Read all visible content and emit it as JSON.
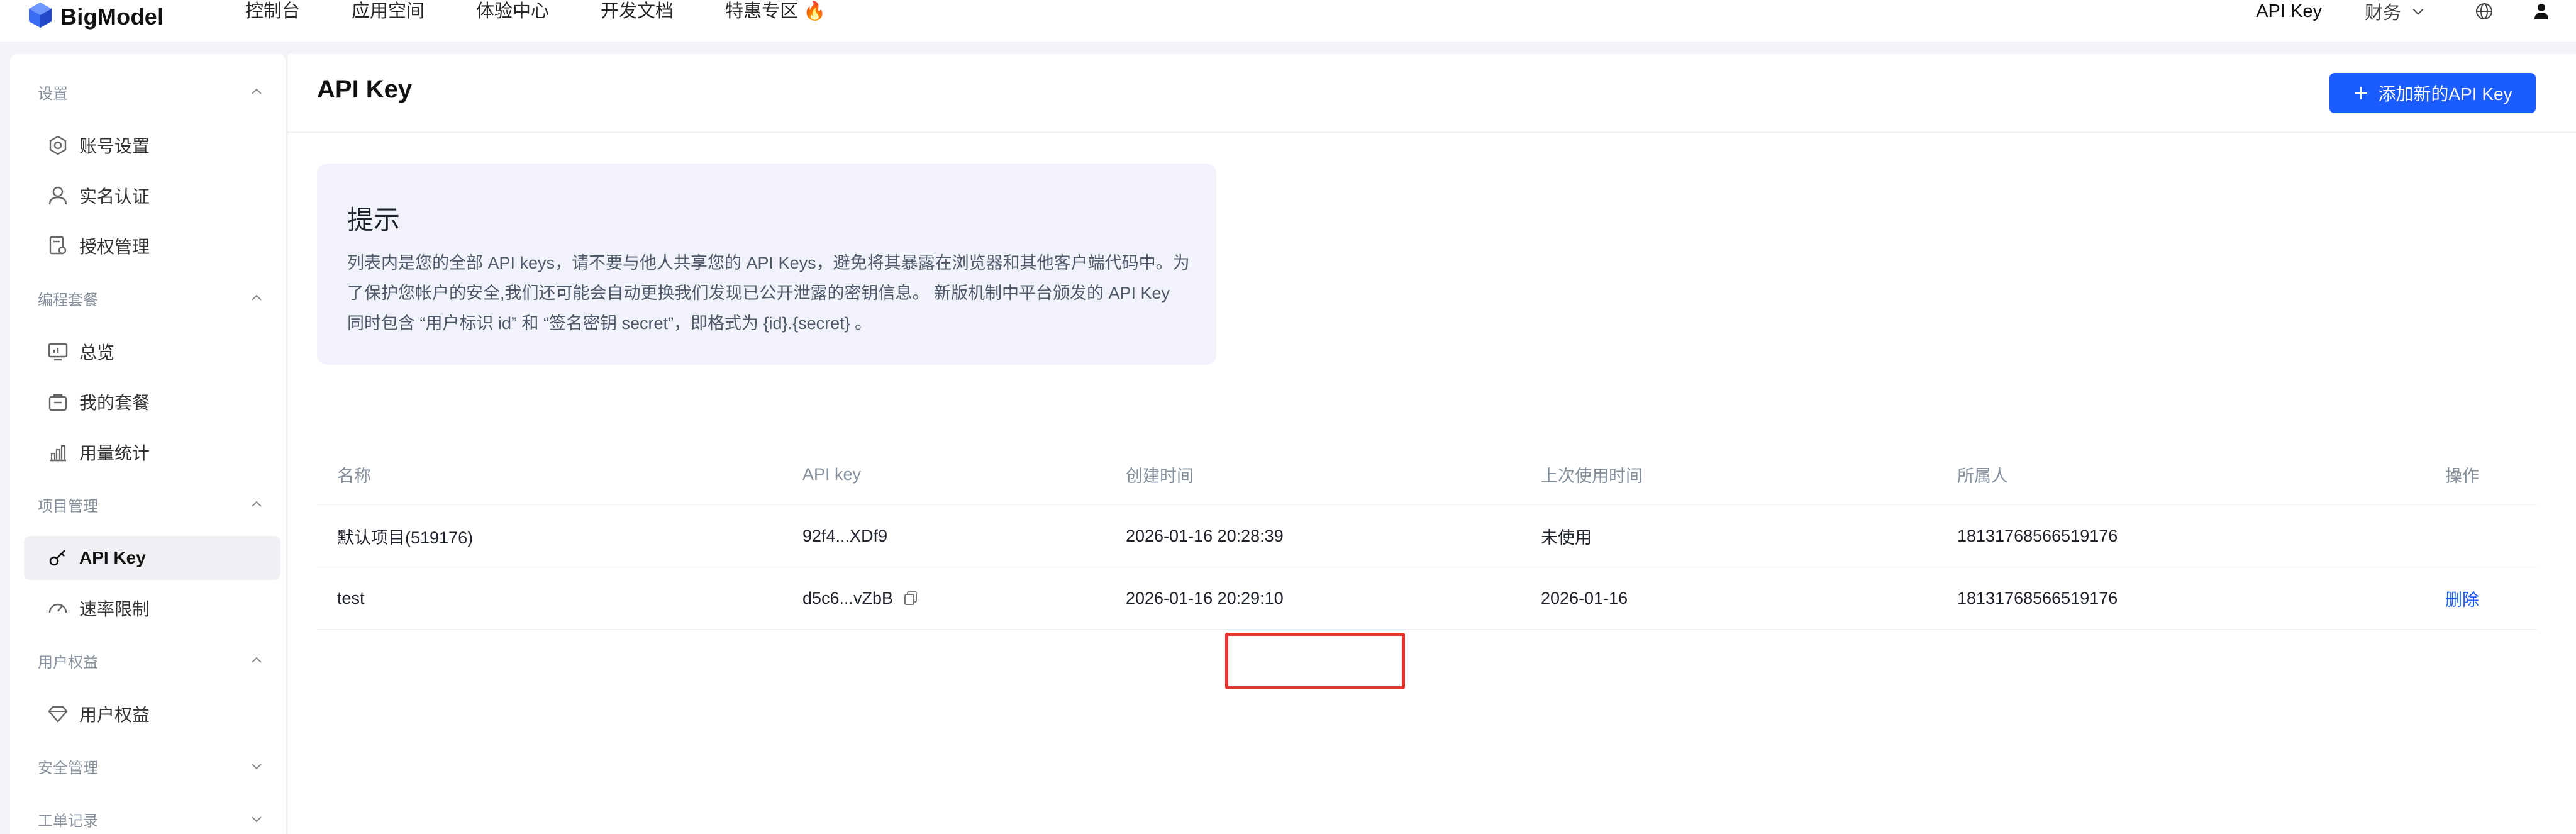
{
  "brand": {
    "name": "BigModel",
    "accent": "#1a5cff",
    "highlight": "#e5322d"
  },
  "top_nav": {
    "items": [
      "控制台",
      "应用空间",
      "体验中心",
      "开发文档",
      "特惠专区 🔥"
    ],
    "right": {
      "apikey": "API Key",
      "finance": "财务"
    }
  },
  "sidebar": {
    "sections": {
      "settings": "设置",
      "coding": "编程套餐",
      "project": "项目管理",
      "rights": "用户权益",
      "security": "安全管理",
      "tickets": "工单记录"
    },
    "items": {
      "account": "账号设置",
      "realname": "实名认证",
      "auth": "授权管理",
      "overview": "总览",
      "plans": "我的套餐",
      "usage": "用量统计",
      "apikey": "API Key",
      "ratelimit": "速率限制",
      "rights": "用户权益"
    }
  },
  "main": {
    "title": "API Key",
    "add_button": "添加新的API Key",
    "tip": {
      "title": "提示",
      "body": "列表内是您的全部 API keys，请不要与他人共享您的 API Keys，避免将其暴露在浏览器和其他客户端代码中。为了保护您帐户的安全,我们还可能会自动更换我们发现已公开泄露的密钥信息。 新版机制中平台颁发的 API Key 同时包含 “用户标识 id” 和 “签名密钥 secret”，即格式为 {id}.{secret} 。"
    },
    "table": {
      "headers": [
        "名称",
        "API key",
        "创建时间",
        "上次使用时间",
        "所属人",
        "操作"
      ],
      "rows": [
        {
          "name": "默认项目(519176)",
          "key": "92f4...XDf9",
          "created": "2026-01-16 20:28:39",
          "last_used": "未使用",
          "owner": "18131768566519176",
          "action": ""
        },
        {
          "name": "test",
          "key": "d5c6...vZbB",
          "created": "2026-01-16 20:29:10",
          "last_used": "2026-01-16",
          "owner": "18131768566519176",
          "action": "删除"
        }
      ]
    }
  }
}
